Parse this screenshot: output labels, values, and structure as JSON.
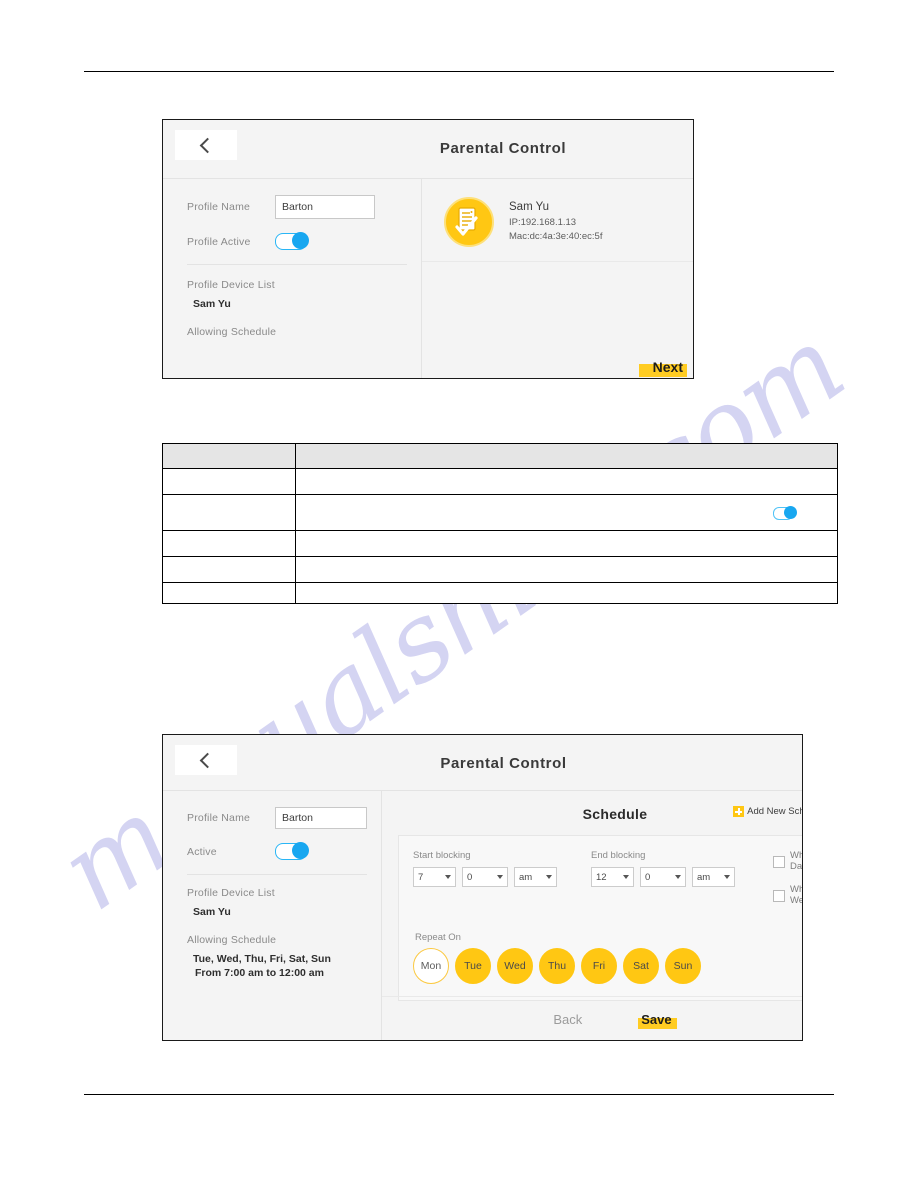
{
  "document": {
    "watermark": "manualshive.com",
    "header_rule": true,
    "footer_rule": true
  },
  "figure_one": {
    "name": "parental-control-profile-screen",
    "back_icon": "chevron-left-icon",
    "title": "Parental Control",
    "form": {
      "profile_name_label": "Profile Name",
      "profile_name_value": "Barton",
      "profile_active_label": "Profile Active",
      "profile_active_state": "on",
      "device_list_label": "Profile Device List",
      "device_list_value": "Sam Yu",
      "allowing_schedule_label": "Allowing Schedule"
    },
    "device_card": {
      "avatar_icon": "checklist-document-icon",
      "name": "Sam Yu",
      "ip": "IP:192.168.1.13",
      "mac": "Mac:dc:4a:3e:40:ec:5f"
    },
    "next_label": "Next"
  },
  "reference_table": {
    "columns": [
      "",
      ""
    ],
    "header": [
      "",
      ""
    ],
    "rows": [
      {
        "label": "",
        "description": ""
      },
      {
        "label": "",
        "description": "",
        "control": "toggle-switch",
        "control_state": "on"
      },
      {
        "label": "",
        "description": ""
      },
      {
        "label": "",
        "description": ""
      },
      {
        "label": "",
        "description": ""
      }
    ]
  },
  "figure_two": {
    "name": "parental-control-schedule-screen",
    "back_icon": "chevron-left-icon",
    "title": "Parental Control",
    "form": {
      "profile_name_label": "Profile Name",
      "profile_name_value": "Barton",
      "active_label": "Active",
      "active_state": "on",
      "device_list_label": "Profile Device List",
      "device_list_value": "Sam Yu",
      "allowing_schedule_label": "Allowing Schedule",
      "allowing_schedule_days": "Tue, Wed, Thu, Fri, Sat, Sun",
      "allowing_schedule_time": "From 7:00 am to 12:00 am"
    },
    "schedule": {
      "title": "Schedule",
      "add_new_label": "Add New Schedule",
      "add_new_icon": "plus-square-icon",
      "start_label": "Start blocking",
      "start_hour": "7",
      "start_minute": "0",
      "start_meridiem": "am",
      "end_label": "End blocking",
      "end_hour": "12",
      "end_minute": "0",
      "end_meridiem": "am",
      "whole_day_label": "Whole Day",
      "whole_day_checked": false,
      "whole_week_label": "Whole Week",
      "whole_week_checked": false,
      "repeat_label": "Repeat On",
      "days": [
        {
          "label": "Mon",
          "selected": false
        },
        {
          "label": "Tue",
          "selected": true
        },
        {
          "label": "Wed",
          "selected": true
        },
        {
          "label": "Thu",
          "selected": true
        },
        {
          "label": "Fri",
          "selected": true
        },
        {
          "label": "Sat",
          "selected": true
        },
        {
          "label": "Sun",
          "selected": true
        }
      ]
    },
    "back_label": "Back",
    "save_label": "Save"
  },
  "colors": {
    "accent_yellow": "#ffc713",
    "highlight_yellow": "#ffcc22",
    "toggle_blue": "#18a7f0",
    "watermark": "#c9c8ef"
  }
}
